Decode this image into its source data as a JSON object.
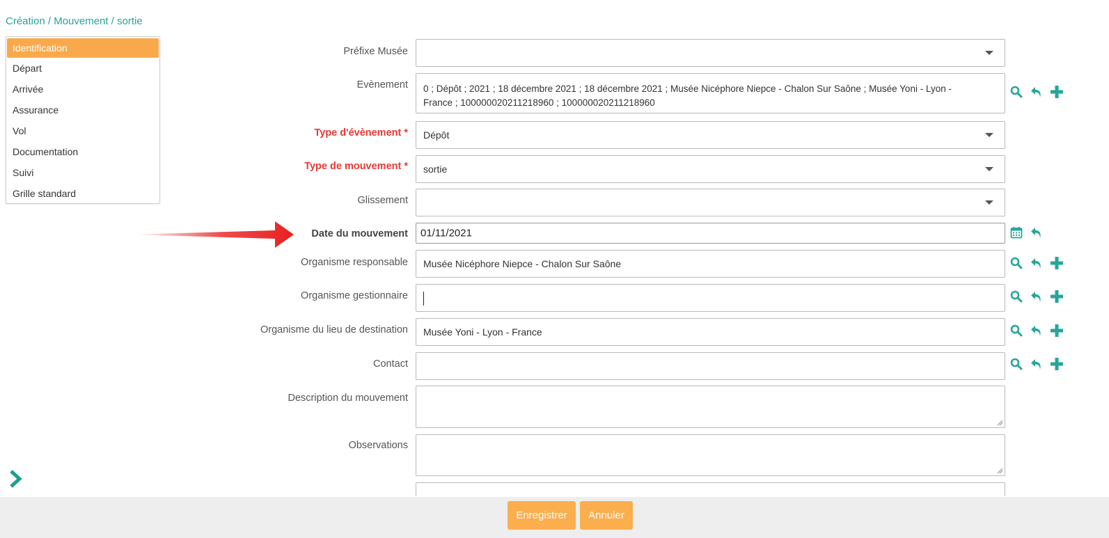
{
  "breadcrumb": "Création / Mouvement / sortie",
  "menu": {
    "items": [
      {
        "label": "Identification",
        "active": true
      },
      {
        "label": "Départ"
      },
      {
        "label": "Arrivée"
      },
      {
        "label": "Assurance"
      },
      {
        "label": "Vol"
      },
      {
        "label": "Documentation"
      },
      {
        "label": "Suivi"
      },
      {
        "label": "Grille standard"
      }
    ]
  },
  "form": {
    "prefixe_musee": {
      "label": "Préfixe Musée",
      "value": ""
    },
    "evenement": {
      "label": "Evènement",
      "value_line1": "0 ; Dépôt ; 2021 ; 18 décembre 2021 ; 18 décembre 2021 ; Musée Nicéphore Niepce - Chalon Sur Saône ; Musée Yoni - Lyon -",
      "value_line2": "France ; 100000020211218960 ; 100000020211218960"
    },
    "type_evenement": {
      "label": "Type d'évènement *",
      "value": "Dépôt"
    },
    "type_mouvement": {
      "label": "Type de mouvement *",
      "value": "sortie"
    },
    "glissement": {
      "label": "Glissement",
      "value": ""
    },
    "date_mouvement": {
      "label": "Date du mouvement",
      "value": "01/11/2021"
    },
    "organisme_responsable": {
      "label": "Organisme responsable",
      "value": "Musée Nicéphore Niepce - Chalon Sur Saône"
    },
    "organisme_gestionnaire": {
      "label": "Organisme gestionnaire",
      "value": ""
    },
    "organisme_destination": {
      "label": "Organisme du lieu de destination",
      "value": "Musée Yoni - Lyon - France"
    },
    "contact": {
      "label": "Contact",
      "value": ""
    },
    "description": {
      "label": "Description du mouvement",
      "value": ""
    },
    "observations": {
      "label": "Observations",
      "value": ""
    }
  },
  "buttons": {
    "save": "Enregistrer",
    "cancel": "Annuler"
  },
  "colors": {
    "accent": "#26a69a",
    "orange": "#fbae4e",
    "required": "#e53935",
    "arrow": "#e82020"
  }
}
